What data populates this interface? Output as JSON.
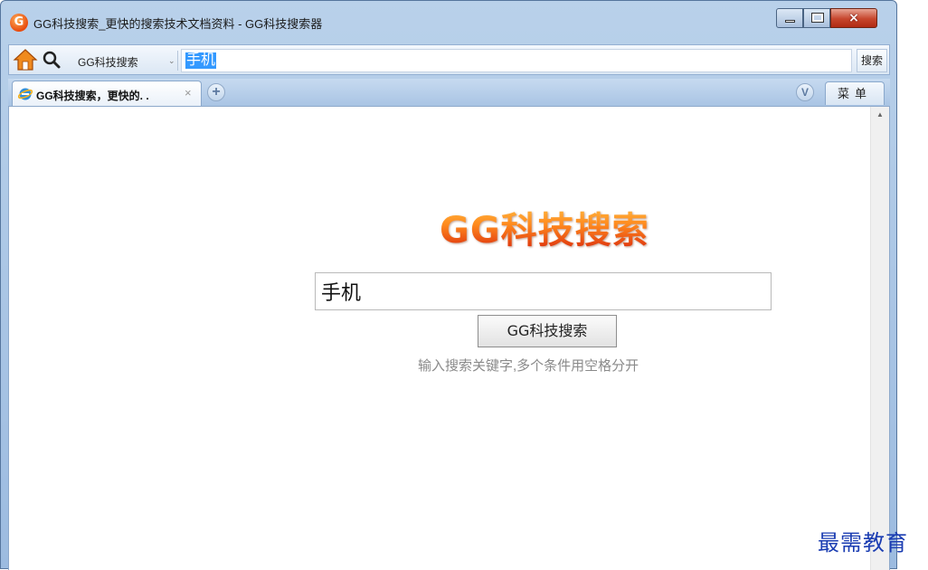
{
  "window": {
    "title": "GG科技搜索_更快的搜索技术文档资料 - GG科技搜索器",
    "app_icon_letter": "G",
    "close_glyph": "×"
  },
  "toolbar": {
    "search_engine": "GG科技搜索",
    "engine_arrow": "⌄",
    "address_value": "手机",
    "go_label": "搜索"
  },
  "tabs": {
    "active_label": "GG科技搜索，更快的. .",
    "close_glyph": "×",
    "new_tab_glyph": "+",
    "v_button": "V",
    "menu_label": "菜单"
  },
  "page": {
    "logo_text": "GG科技搜索",
    "search_value": "手机",
    "search_button": "GG科技搜索",
    "hint": "输入搜索关键字,多个条件用空格分开",
    "scroll_up_glyph": "▲"
  },
  "watermark": "最需教育",
  "colors": {
    "accent": "#3399ff",
    "logo_orange": "#f0590f",
    "watermark": "#1b3db2"
  }
}
